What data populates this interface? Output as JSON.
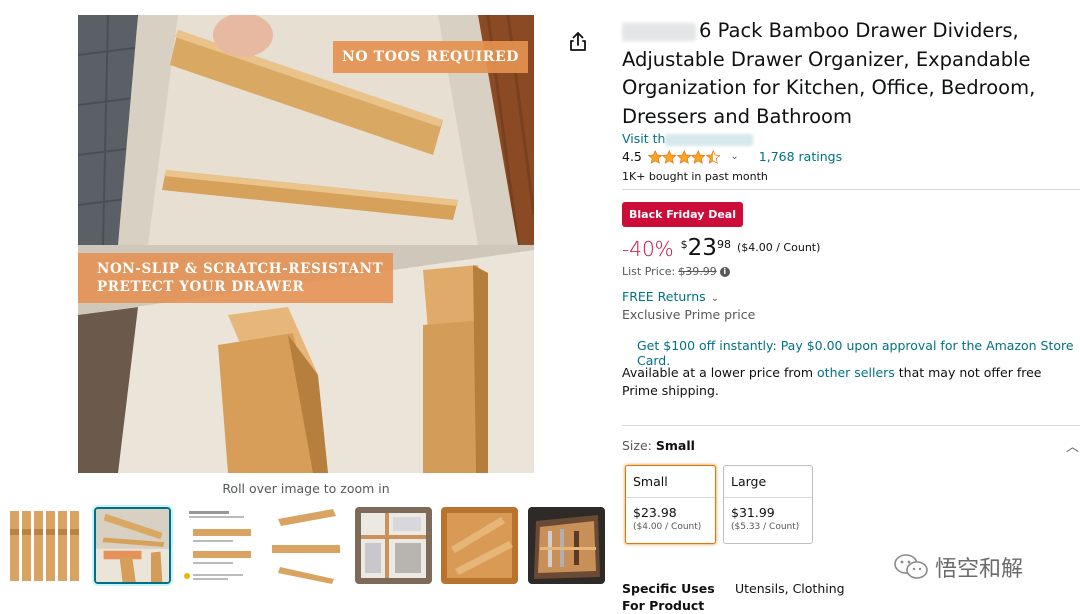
{
  "product": {
    "title": "6 Pack Bamboo Drawer Dividers, Adjustable Drawer Organizer, Expandable Organization for Kitchen, Office, Bedroom, Dressers and Bathroom",
    "store_link": "Visit th",
    "rating_value": "4.5",
    "rating_stars": 4.5,
    "ratings_count": "1,768 ratings",
    "bought": "1K+ bought in past month"
  },
  "gallery": {
    "banner_top": "NO TOOS REQUIRED",
    "banner_mid_line1": "NON-SLIP & SCRATCH-RESISTANT",
    "banner_mid_line2": "PRETECT YOUR DRAWER",
    "zoom_hint": "Roll over image to zoom in",
    "thumbnails": [
      "dividers-standing",
      "drawer-closeup",
      "size-guide",
      "divider-dimensions",
      "drawer-packed",
      "drawer-utensils",
      "drawer-kitchen"
    ],
    "selected_thumbnail": 1
  },
  "deal": {
    "badge": "Black Friday Deal",
    "badge_color": "#CC0C39",
    "discount": "-40%",
    "currency": "$",
    "price_whole": "23",
    "price_fraction": "98",
    "unit_price": "($4.00 / Count)",
    "list_price_label": "List Price:",
    "list_price": "$39.99"
  },
  "shipping": {
    "free_returns": "FREE Returns",
    "prime_price": "Exclusive Prime price",
    "store_card_offer": "Get $100 off instantly: Pay $0.00 upon approval for the Amazon Store Card.",
    "lower_price_prefix": "Available at a lower price from ",
    "lower_price_link": "other sellers",
    "lower_price_suffix": " that may not offer free Prime shipping."
  },
  "size": {
    "label": "Size: ",
    "selected": "Small",
    "options": [
      {
        "name": "Small",
        "price": "$23.98",
        "unit": "($4.00 / Count)"
      },
      {
        "name": "Large",
        "price": "$31.99",
        "unit": "($5.33 / Count)"
      }
    ]
  },
  "specs": {
    "uses_label": "Specific Uses For Product",
    "uses_value": "Utensils, Clothing"
  },
  "watermark": "悟空和解",
  "colors": {
    "link": "#007185",
    "deal_red": "#CC0C39",
    "star": "#FFA41C",
    "selected_tile": "#e77600"
  }
}
